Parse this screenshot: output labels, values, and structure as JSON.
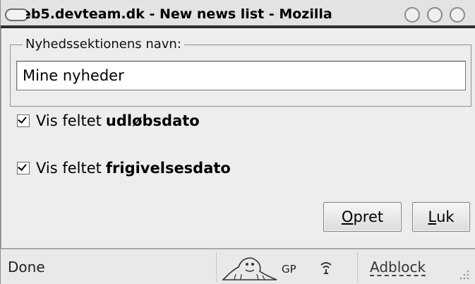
{
  "window": {
    "title": "eb5.devteam.dk - New news list - Mozilla"
  },
  "form": {
    "name_group_legend": "Nyhedssektionens navn:",
    "name_value": "Mine nyheder",
    "checkboxes": [
      {
        "prefix": "Vis feltet",
        "field": "udløbsdato",
        "checked": true
      },
      {
        "prefix": "Vis feltet",
        "field": "frigivelsesdato",
        "checked": true
      }
    ],
    "buttons": {
      "create_access": "O",
      "create_rest": "pret",
      "close_access": "L",
      "close_rest": "uk"
    }
  },
  "statusbar": {
    "status": "Done",
    "gp": "GP",
    "adblock": "Adblock"
  }
}
